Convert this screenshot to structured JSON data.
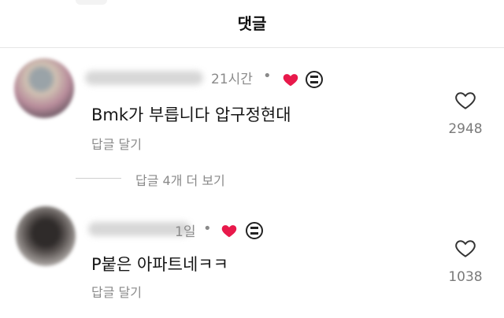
{
  "header": {
    "title": "댓글"
  },
  "comments": [
    {
      "time": "21시간",
      "dot": "•",
      "text": "Bmk가 부릅니다 압구정현대",
      "reply_label": "답글 달기",
      "like_count": "2948",
      "icons": {
        "like": "heart-outline-icon",
        "creator_liked": "heart-filled-icon",
        "sticker": "sticker-icon"
      }
    },
    {
      "time": "1일",
      "dot": "•",
      "text": "P붙은 아파트네ㅋㅋ",
      "reply_label": "답글 달기",
      "like_count": "1038",
      "icons": {
        "like": "heart-outline-icon",
        "creator_liked": "heart-filled-icon",
        "sticker": "sticker-icon"
      }
    }
  ],
  "view_replies": {
    "label": "답글 4개 더 보기"
  },
  "colors": {
    "heart": "#e8194b",
    "muted_text": "#8a8a8a",
    "divider": "#e6e6e6"
  }
}
